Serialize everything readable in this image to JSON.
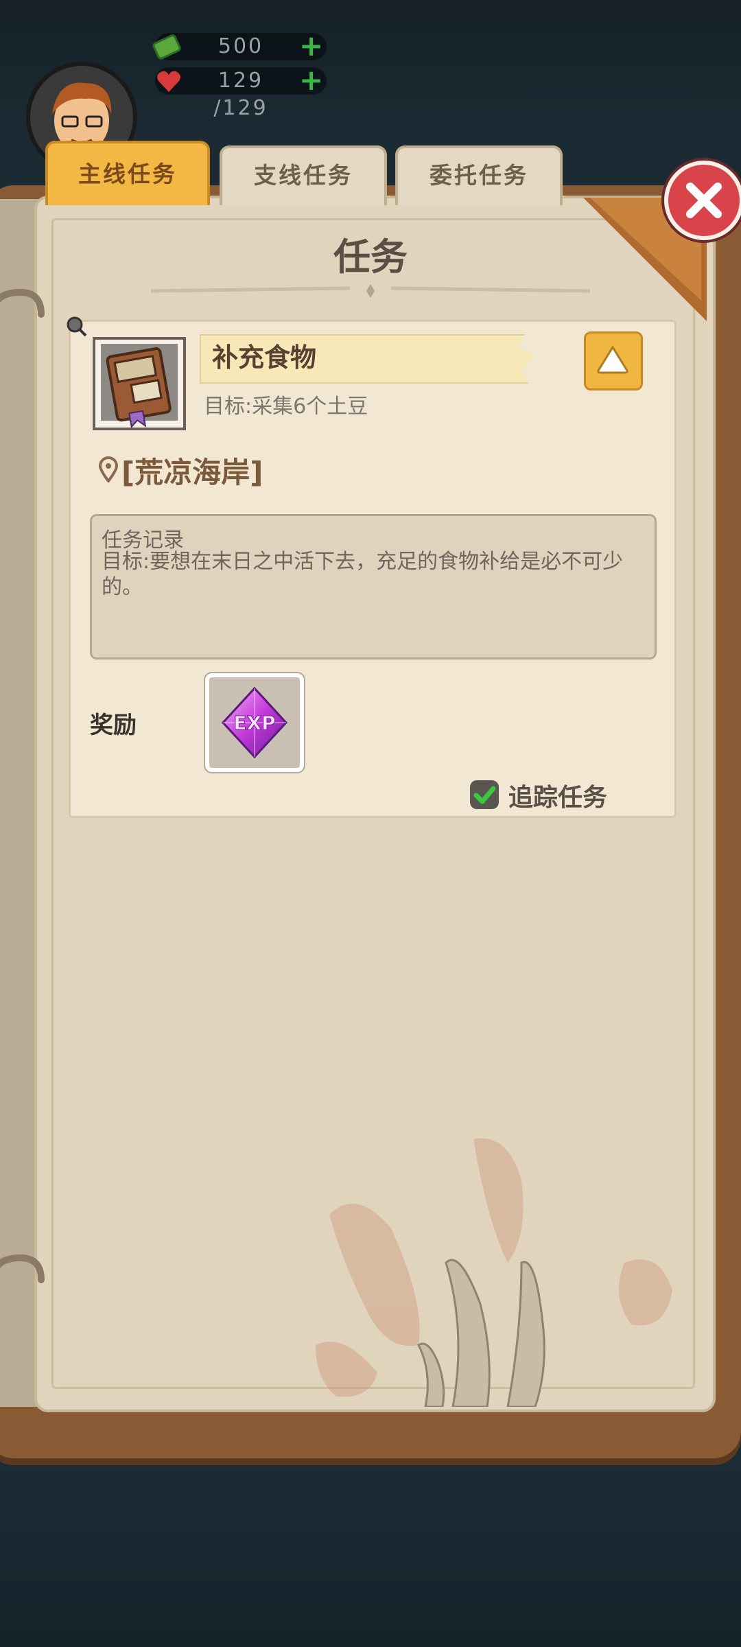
{
  "hud": {
    "money": "500",
    "health": "129 /129",
    "money_plus": "+",
    "health_plus": "+"
  },
  "tabs": [
    {
      "label": "主线任务",
      "active": true
    },
    {
      "label": "支线任务",
      "active": false
    },
    {
      "label": "委托任务",
      "active": false
    }
  ],
  "page_title": "任务",
  "quest": {
    "name": "补充食物",
    "goal": "目标:采集6个土豆",
    "location": "[荒凉海岸]",
    "record_title": "任务记录",
    "record_text": "目标:要想在末日之中活下去，充足的食物补给是必不可少的。",
    "reward_label": "奖励",
    "reward_item": "EXP",
    "track_label": "追踪任务",
    "track_checked": true
  },
  "colors": {
    "active_tab": "#f2b843",
    "close_button": "#d9434a",
    "track_check": "#3cc83c"
  }
}
